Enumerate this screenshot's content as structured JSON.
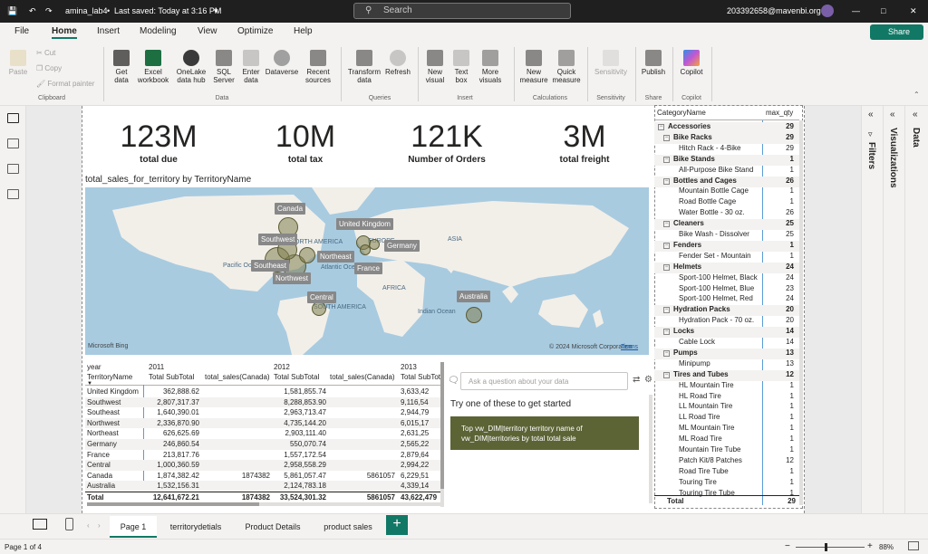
{
  "titlebar": {
    "file_name": "amina_lab4",
    "saved_status": "Last saved: Today at 3:16 PM",
    "search_placeholder": "Search",
    "account": "203392658@mavenbi.org"
  },
  "menu": {
    "items": [
      "File",
      "Home",
      "Insert",
      "Modeling",
      "View",
      "Optimize",
      "Help"
    ],
    "active": "Home",
    "share_label": "Share"
  },
  "ribbon": {
    "clipboard": {
      "paste": "Paste",
      "cut": "Cut",
      "copy": "Copy",
      "format_painter": "Format painter",
      "group": "Clipboard"
    },
    "data": {
      "get_data": "Get data",
      "excel": "Excel workbook",
      "onelake": "OneLake data hub",
      "sql": "SQL Server",
      "enter": "Enter data",
      "dataverse": "Dataverse",
      "recent": "Recent sources",
      "group": "Data"
    },
    "queries": {
      "transform": "Transform data",
      "refresh": "Refresh",
      "group": "Queries"
    },
    "insert": {
      "new_visual": "New visual",
      "text_box": "Text box",
      "more_visuals": "More visuals",
      "group": "Insert"
    },
    "calculations": {
      "new_measure": "New measure",
      "quick_measure": "Quick measure",
      "group": "Calculations"
    },
    "sensitivity": {
      "label": "Sensitivity",
      "group": "Sensitivity"
    },
    "share": {
      "publish": "Publish",
      "group": "Share"
    },
    "copilot": {
      "label": "Copilot",
      "group": "Copilot"
    }
  },
  "cards": [
    {
      "value": "123M",
      "label": "total due"
    },
    {
      "value": "10M",
      "label": "total tax"
    },
    {
      "value": "121K",
      "label": "Number of Orders"
    },
    {
      "value": "3M",
      "label": "total freight"
    }
  ],
  "map": {
    "title": "total_sales_for_territory by TerritoryName",
    "labels": [
      "Canada",
      "Southwest",
      "Southeast",
      "Northwest",
      "Northeast",
      "Central",
      "United Kingdom",
      "Germany",
      "France",
      "Australia"
    ],
    "ocean_labels": [
      "NORTH AMERICA",
      "Pacific Ocean",
      "Atlantic Ocean",
      "EUROPE",
      "ASIA",
      "AFRICA",
      "SOUTH AMERICA",
      "Indian Ocean"
    ],
    "attribution": "© 2024 Microsoft Corporation",
    "terms": "Terms",
    "bing": "Microsoft Bing"
  },
  "matrix": {
    "header_year": "year",
    "header_territory": "TerritoryName",
    "years": [
      "2011",
      "2012",
      "2013"
    ],
    "col_subtotal": "Total SubTotal",
    "col_canada": "total_sales(Canada)",
    "rows": [
      {
        "name": "United Kingdom",
        "v2011": "362,888.62",
        "c2011": "",
        "v2012": "1,581,855.74",
        "c2012": "",
        "v2013": "3,633,42"
      },
      {
        "name": "Southwest",
        "v2011": "2,807,317.37",
        "c2011": "",
        "v2012": "8,288,853.90",
        "c2012": "",
        "v2013": "9,116,54"
      },
      {
        "name": "Southeast",
        "v2011": "1,640,390.01",
        "c2011": "",
        "v2012": "2,963,713.47",
        "c2012": "",
        "v2013": "2,944,79"
      },
      {
        "name": "Northwest",
        "v2011": "2,336,870.90",
        "c2011": "",
        "v2012": "4,735,144.20",
        "c2012": "",
        "v2013": "6,015,17"
      },
      {
        "name": "Northeast",
        "v2011": "626,625.69",
        "c2011": "",
        "v2012": "2,903,111.40",
        "c2012": "",
        "v2013": "2,631,25"
      },
      {
        "name": "Germany",
        "v2011": "246,860.54",
        "c2011": "",
        "v2012": "550,070.74",
        "c2012": "",
        "v2013": "2,565,22"
      },
      {
        "name": "France",
        "v2011": "213,817.76",
        "c2011": "",
        "v2012": "1,557,172.54",
        "c2012": "",
        "v2013": "2,879,64"
      },
      {
        "name": "Central",
        "v2011": "1,000,360.59",
        "c2011": "",
        "v2012": "2,958,558.29",
        "c2012": "",
        "v2013": "2,994,22"
      },
      {
        "name": "Canada",
        "v2011": "1,874,382.42",
        "c2011": "1874382",
        "v2012": "5,861,057.47",
        "c2012": "5861057",
        "v2013": "6,229,51"
      },
      {
        "name": "Australia",
        "v2011": "1,532,156.31",
        "c2011": "",
        "v2012": "2,124,783.18",
        "c2012": "",
        "v2013": "4,339,14"
      }
    ],
    "total": {
      "name": "Total",
      "v2011": "12,641,672.21",
      "c2011": "1874382",
      "v2012": "33,524,301.32",
      "c2012": "5861057",
      "v2013": "43,622,479"
    }
  },
  "qa": {
    "placeholder": "Ask a question about your data",
    "hint": "Try one of these to get started",
    "suggestion": "Top vw_DIM|territory territory name of vw_DIM|territories by total total sale"
  },
  "category_matrix": {
    "header_name": "CategoryName",
    "header_qty": "max_qty",
    "rows": [
      {
        "level": 0,
        "label": "Accessories",
        "qty": "29"
      },
      {
        "level": 1,
        "label": "Bike Racks",
        "qty": "29"
      },
      {
        "level": 2,
        "label": "Hitch Rack - 4-Bike",
        "qty": "29"
      },
      {
        "level": 1,
        "label": "Bike Stands",
        "qty": "1"
      },
      {
        "level": 2,
        "label": "All-Purpose Bike Stand",
        "qty": "1"
      },
      {
        "level": 1,
        "label": "Bottles and Cages",
        "qty": "26"
      },
      {
        "level": 2,
        "label": "Mountain Bottle Cage",
        "qty": "1"
      },
      {
        "level": 2,
        "label": "Road Bottle Cage",
        "qty": "1"
      },
      {
        "level": 2,
        "label": "Water Bottle - 30 oz.",
        "qty": "26"
      },
      {
        "level": 1,
        "label": "Cleaners",
        "qty": "25"
      },
      {
        "level": 2,
        "label": "Bike Wash - Dissolver",
        "qty": "25"
      },
      {
        "level": 1,
        "label": "Fenders",
        "qty": "1"
      },
      {
        "level": 2,
        "label": "Fender Set - Mountain",
        "qty": "1"
      },
      {
        "level": 1,
        "label": "Helmets",
        "qty": "24"
      },
      {
        "level": 2,
        "label": "Sport-100 Helmet, Black",
        "qty": "24"
      },
      {
        "level": 2,
        "label": "Sport-100 Helmet, Blue",
        "qty": "23"
      },
      {
        "level": 2,
        "label": "Sport-100 Helmet, Red",
        "qty": "24"
      },
      {
        "level": 1,
        "label": "Hydration Packs",
        "qty": "20"
      },
      {
        "level": 2,
        "label": "Hydration Pack - 70 oz.",
        "qty": "20"
      },
      {
        "level": 1,
        "label": "Locks",
        "qty": "14"
      },
      {
        "level": 2,
        "label": "Cable Lock",
        "qty": "14"
      },
      {
        "level": 1,
        "label": "Pumps",
        "qty": "13"
      },
      {
        "level": 2,
        "label": "Minipump",
        "qty": "13"
      },
      {
        "level": 1,
        "label": "Tires and Tubes",
        "qty": "12"
      },
      {
        "level": 2,
        "label": "HL Mountain Tire",
        "qty": "1"
      },
      {
        "level": 2,
        "label": "HL Road Tire",
        "qty": "1"
      },
      {
        "level": 2,
        "label": "LL Mountain Tire",
        "qty": "1"
      },
      {
        "level": 2,
        "label": "LL Road Tire",
        "qty": "1"
      },
      {
        "level": 2,
        "label": "ML Mountain Tire",
        "qty": "1"
      },
      {
        "level": 2,
        "label": "ML Road Tire",
        "qty": "1"
      },
      {
        "level": 2,
        "label": "Mountain Tire Tube",
        "qty": "1"
      },
      {
        "level": 2,
        "label": "Patch Kit/8 Patches",
        "qty": "12"
      },
      {
        "level": 2,
        "label": "Road Tire Tube",
        "qty": "1"
      },
      {
        "level": 2,
        "label": "Touring Tire",
        "qty": "1"
      },
      {
        "level": 2,
        "label": "Touring Tire Tube",
        "qty": "1"
      }
    ],
    "total": {
      "label": "Total",
      "qty": "29"
    }
  },
  "panes": {
    "filters": "Filters",
    "visualizations": "Visualizations",
    "data": "Data"
  },
  "tabs": [
    "Page 1",
    "territorydetials",
    "Product Details",
    "product sales"
  ],
  "active_tab": "Page 1",
  "status": {
    "page": "Page 1 of 4",
    "zoom": "88%"
  }
}
